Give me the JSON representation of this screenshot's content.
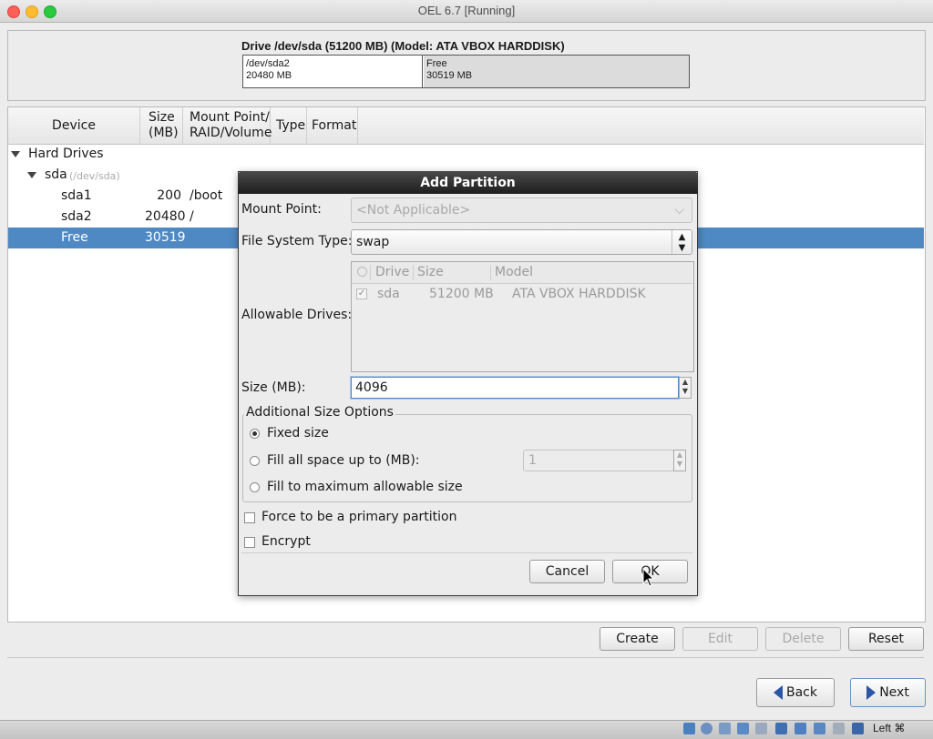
{
  "window": {
    "title": "OEL 6.7 [Running]"
  },
  "drive": {
    "title": "Drive /dev/sda (51200 MB) (Model: ATA VBOX HARDDISK)",
    "segments": [
      {
        "name": "/dev/sda2",
        "size": "20480 MB"
      },
      {
        "name": "Free",
        "size": "30519 MB"
      }
    ]
  },
  "table": {
    "headers": {
      "device": "Device",
      "size1": "Size",
      "size2": "(MB)",
      "mount1": "Mount Point/",
      "mount2": "RAID/Volume",
      "type": "Type",
      "format": "Format"
    },
    "tree": {
      "group": "Hard Drives",
      "disk": "sda",
      "disk_path": "(/dev/sda)",
      "rows": [
        {
          "device": "sda1",
          "size": "200",
          "mount": "/boot"
        },
        {
          "device": "sda2",
          "size": "20480",
          "mount": "/"
        },
        {
          "device": "Free",
          "size": "30519",
          "mount": ""
        }
      ]
    }
  },
  "actions": {
    "create": "Create",
    "edit": "Edit",
    "delete": "Delete",
    "reset": "Reset"
  },
  "nav": {
    "back": "Back",
    "next": "Next"
  },
  "dialog": {
    "title": "Add Partition",
    "mount_label": "Mount Point:",
    "mount_value": "<Not Applicable>",
    "fstype_label": "File System Type:",
    "fstype_value": "swap",
    "drives_label": "Allowable Drives:",
    "drives_headers": {
      "drive": "Drive",
      "size": "Size",
      "model": "Model"
    },
    "drives_rows": [
      {
        "drive": "sda",
        "size": "51200 MB",
        "model": "ATA VBOX HARDDISK"
      }
    ],
    "size_label": "Size (MB):",
    "size_value": "4096",
    "options_title": "Additional Size Options",
    "opt_fixed": "Fixed size",
    "opt_fill_upto": "Fill all space up to (MB):",
    "opt_fill_upto_value": "1",
    "opt_fill_max": "Fill to maximum allowable size",
    "force_primary": "Force to be a primary partition",
    "encrypt": "Encrypt",
    "cancel": "Cancel",
    "ok": "OK"
  },
  "statusbar": {
    "host_key": "Left ⌘"
  },
  "colors": {
    "selection": "#4f89c3",
    "accent": "#2b56a5"
  }
}
